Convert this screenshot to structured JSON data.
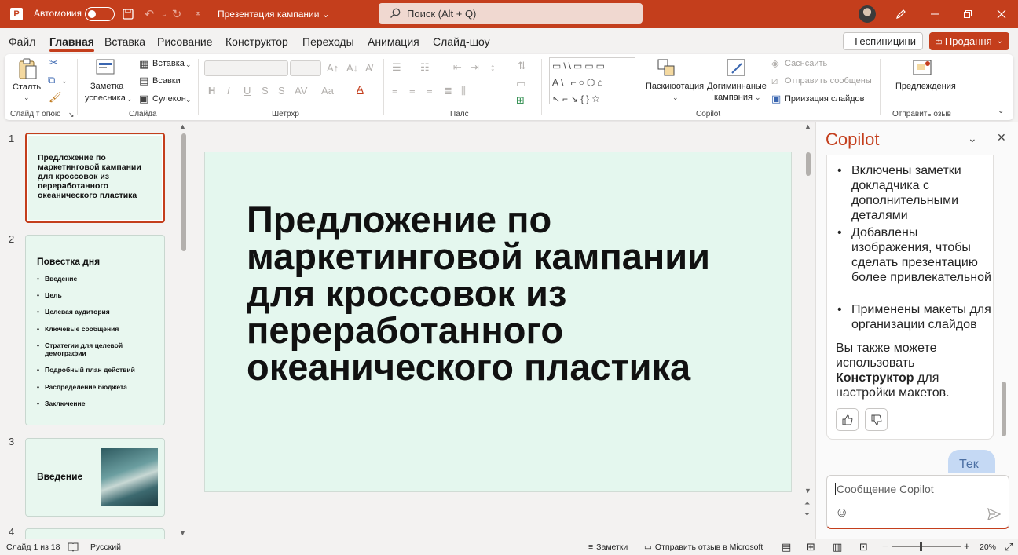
{
  "titlebar": {
    "autosave_label": "Автомоиия",
    "doc_name": "Презентация кампании ⌄",
    "search_placeholder": "Поиск (Alt + Q)",
    "logo_letter": "P"
  },
  "menu": {
    "items": [
      "Файл",
      "Главная",
      "Вставка",
      "Рисование",
      "Конструктор",
      "Переходы",
      "Анимация",
      "Слайд-шоу"
    ],
    "active_index": 1,
    "present_label": "Геспиницини",
    "share_label": "Продання"
  },
  "ribbon": {
    "clipboard": {
      "paste": "Сталть",
      "group": "Слайд т огюю"
    },
    "slides": {
      "new_slide_1": "Заметка",
      "new_slide_2": "успесника",
      "insert": "Вставка",
      "insert2": "Всавки",
      "sections": "Сулекон",
      "group": "Слайда"
    },
    "font": {
      "group": "Шетрхр"
    },
    "paragraph": {
      "group": "Палс"
    },
    "drawing": {
      "arrange": "Паскиюотация",
      "designer_1": "Догиминнаные",
      "designer_2": "кампания",
      "action1": "Саснсаить",
      "action2": "Отправить сообщены",
      "action3": "Приизация слайдов",
      "group": "Copilot"
    },
    "feedback": {
      "label": "Предлеждения",
      "group": "Отправить озыв"
    }
  },
  "slides": [
    {
      "num": "1",
      "title": "Предложение по маркетинговой кампании для кроссовок из переработанного океанического пластика"
    },
    {
      "num": "2",
      "title": "Повестка дня",
      "bullets": [
        "Введение",
        "Цель",
        "Целевая аудитория",
        "Ключевые сообщения",
        "Стратегии для целевой демографии",
        "Подробный план действий",
        "Распределение бюджета",
        "Заключение"
      ]
    },
    {
      "num": "3",
      "title": "Введение"
    },
    {
      "num": "4"
    }
  ],
  "main_slide": {
    "title": "Предложение по маркетинговой кампании для кроссовок из переработанного океанического пластика"
  },
  "copilot": {
    "title": "Copilot",
    "bullets": [
      "Включены заметки докладчика с дополнительными деталями",
      "Добавлены изображения, чтобы сделать презентацию более привлекательной",
      "Применены макеты для организации слайдов"
    ],
    "para_start": "Вы также можете использовать ",
    "para_bold": "Конструктор",
    "para_end": " для настройки макетов.",
    "user_bubble": "Тек",
    "input_placeholder": "Сообщение Copilot"
  },
  "status": {
    "slide_of": "Слайд 1 из 18",
    "language": "Русский",
    "notes": "Заметки",
    "feedback": "Отправить отзыв в Microsoft",
    "zoom": "20%"
  },
  "colors": {
    "accent": "#c43e1c",
    "slide_bg": "#e4f7ee"
  }
}
